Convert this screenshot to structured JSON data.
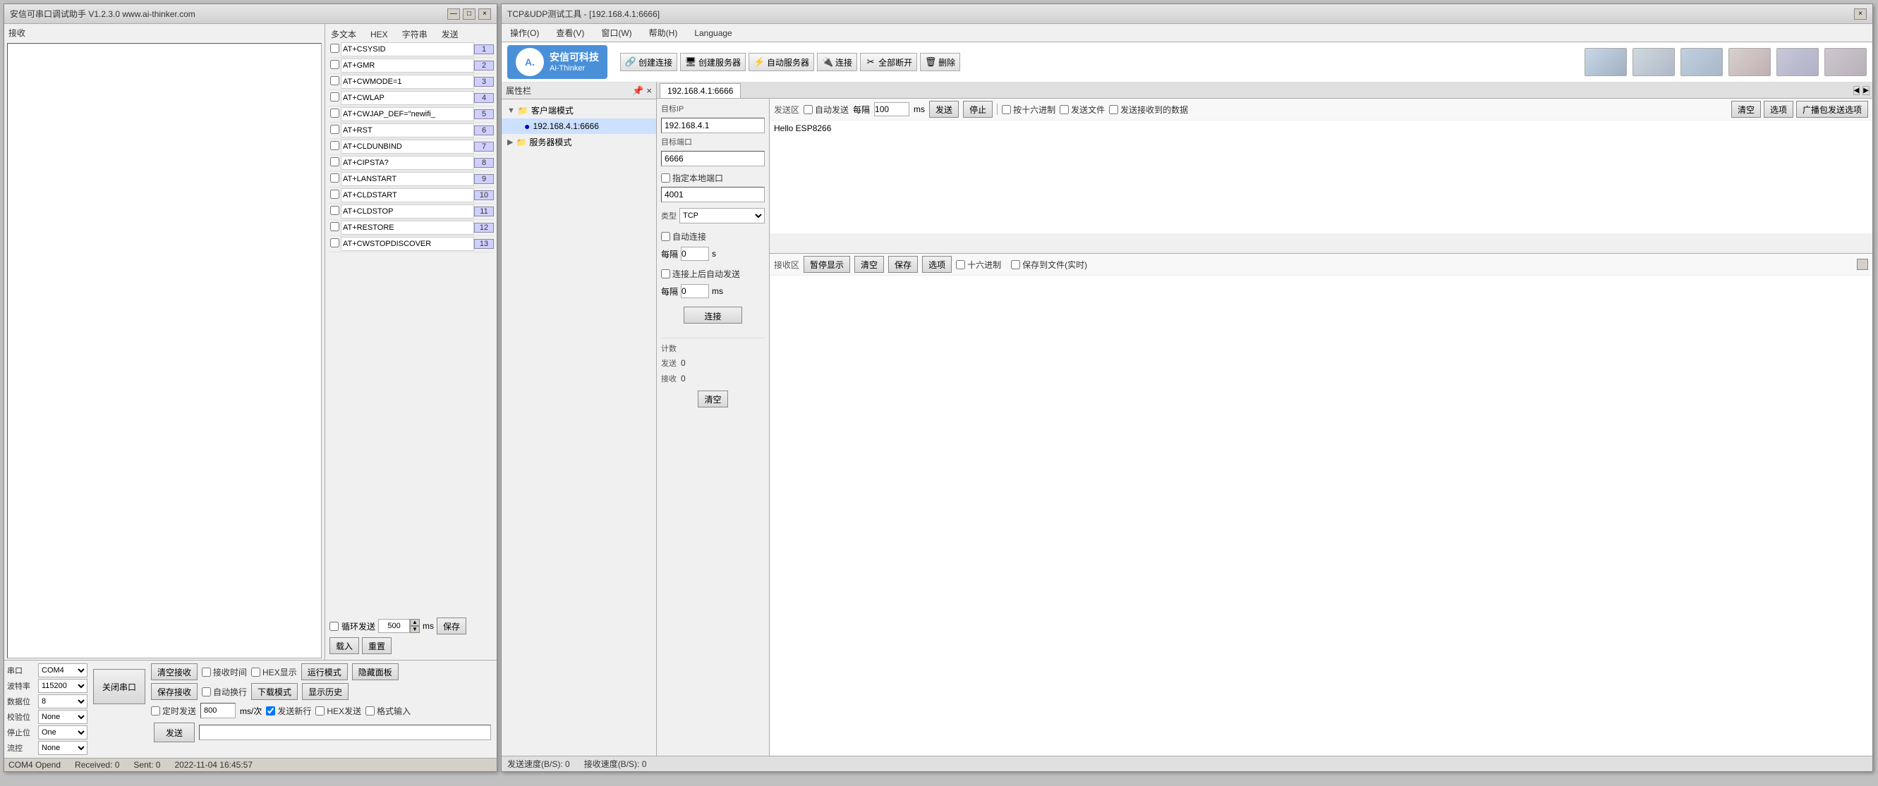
{
  "left_window": {
    "title": "安信可串口调试助手 V1.2.3.0   www.ai-thinker.com",
    "controls": [
      "—",
      "□",
      "×"
    ],
    "receive_label": "接收",
    "multitext": {
      "hex_label": "HEX",
      "char_label": "字符串",
      "send_label": "发送",
      "rows": [
        {
          "checked": false,
          "text": "AT+CSYSID",
          "num": "1"
        },
        {
          "checked": false,
          "text": "AT+GMR",
          "num": "2"
        },
        {
          "checked": false,
          "text": "AT+CWMODE=1",
          "num": "3"
        },
        {
          "checked": false,
          "text": "AT+CWLAP",
          "num": "4"
        },
        {
          "checked": false,
          "text": "AT+CWJAP_DEF=\"newifi_",
          "num": "5"
        },
        {
          "checked": false,
          "text": "AT+RST",
          "num": "6"
        },
        {
          "checked": false,
          "text": "AT+CLDUNBIND",
          "num": "7"
        },
        {
          "checked": false,
          "text": "AT+CIPSTA?",
          "num": "8"
        },
        {
          "checked": false,
          "text": "AT+LANSTART",
          "num": "9"
        },
        {
          "checked": false,
          "text": "AT+CLDSTART",
          "num": "10"
        },
        {
          "checked": false,
          "text": "AT+CLDSTOP",
          "num": "11"
        },
        {
          "checked": false,
          "text": "AT+RESTORE",
          "num": "12"
        },
        {
          "checked": false,
          "text": "AT+CWSTOPDISCOVER",
          "num": "13"
        }
      ],
      "loop_send": "循环发送",
      "loop_ms_label": "ms",
      "loop_value": "500",
      "save_btn": "保存",
      "load_btn": "载入",
      "reset_btn": "重置"
    },
    "serial_params": {
      "port_label": "串口",
      "port_value": "COM4",
      "baud_label": "波特率",
      "baud_value": "115200",
      "data_label": "数据位",
      "data_value": "8",
      "parity_label": "校验位",
      "parity_value": "None",
      "stop_label": "停止位",
      "stop_value": "One",
      "flow_label": "流控",
      "flow_value": "None"
    },
    "open_port_btn": "关闭串口",
    "clear_recv_btn": "清空接收",
    "save_recv_btn": "保存接收",
    "recv_time_cb": "接收时间",
    "hex_display_cb": "HEX显示",
    "run_mode_btn": "运行模式",
    "hide_panel_btn": "隐藏面板",
    "auto_newline_cb": "自动换行",
    "download_mode_btn": "下载模式",
    "show_history_btn": "显示历史",
    "timed_send_cb": "定时发送",
    "timed_value": "800",
    "timed_unit": "ms/次",
    "send_newline_cb": "发送新行",
    "hex_send_cb": "HEX发送",
    "format_input_cb": "格式输入",
    "send_btn": "发送",
    "send_input_placeholder": "",
    "status": {
      "port_status": "COM4 Opend",
      "received": "Received: 0",
      "sent": "Sent: 0",
      "datetime": "2022-11-04 16:45:57"
    }
  },
  "right_window": {
    "title": "TCP&UDP测试工具 - [192.168.4.1:6666]",
    "controls": [
      "×"
    ],
    "menu": {
      "items": [
        "操作(O)",
        "查看(V)",
        "窗口(W)",
        "帮助(H)",
        "Language"
      ]
    },
    "toolbar": {
      "create_conn_btn": "创建连接",
      "create_server_btn": "创建服务器",
      "auto_server_btn": "自动服务器",
      "connect_btn": "连接",
      "disconnect_all_btn": "全部断开",
      "delete_btn": "删除"
    },
    "logo": {
      "icon": "A.",
      "company": "安信可科技",
      "brand": "Ai-Thinker"
    },
    "properties_panel": {
      "title": "属性栏",
      "tree": {
        "client_mode": "客户端模式",
        "client_ip": "192.168.4.1:6666",
        "server_mode": "服务器模式"
      }
    },
    "tab": {
      "label": "192.168.4.1:6666"
    },
    "connection": {
      "target_ip_label": "目标IP",
      "target_ip": "192.168.4.1",
      "target_port_label": "目标端口",
      "target_port": "6666",
      "specify_local_port_cb": "指定本地端口",
      "local_port": "4001",
      "type_label": "类型",
      "type_value": "TCP",
      "auto_connect_cb": "自动连接",
      "interval_label": "每隔",
      "interval_value": "0",
      "interval_unit": "s",
      "auto_send_after_cb": "连接上后自动发送",
      "interval2_label": "每隔",
      "interval2_value": "0",
      "interval2_unit": "ms",
      "connect_btn": "连接",
      "counter": {
        "label": "计数",
        "send_label": "发送",
        "send_value": "0",
        "recv_label": "接收",
        "recv_value": "0",
        "clear_btn": "清空"
      }
    },
    "send_section": {
      "auto_send_cb": "自动发送",
      "interval_label": "每隔",
      "interval_value": "100",
      "interval_unit": "ms",
      "send_btn": "发送",
      "stop_btn": "停止",
      "hex_mode_cb": "按十六进制",
      "send_file_cb": "发送文件",
      "send_recv_cb": "发送接收到的数据",
      "clear_btn": "清空",
      "options_btn": "选项",
      "broadcast_btn": "广播包发送选项",
      "content": "Hello ESP8266"
    },
    "recv_section": {
      "pause_btn": "暂停显示",
      "clear_btn": "清空",
      "save_btn": "保存",
      "options_btn": "选项",
      "hex_cb": "十六进制",
      "save_file_cb": "保存到文件(实时)",
      "content": ""
    },
    "status_bar": {
      "send_speed": "发送速度(B/S): 0",
      "recv_speed": "接收速度(B/S): 0"
    }
  }
}
